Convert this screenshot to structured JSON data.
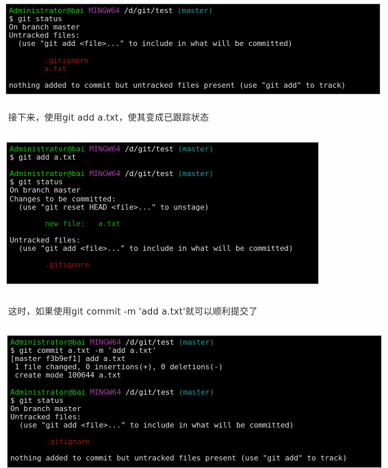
{
  "page": {
    "background": "#fefefe",
    "terminal_background": "#000000",
    "colors": {
      "user": "#19c419",
      "host": "#a43fa4",
      "path": "#e6e6e6",
      "branch": "#2a9d9d",
      "plain": "#dcdcdc",
      "untracked_red": "#a81414",
      "staged_green": "#19a819"
    }
  },
  "prompt": {
    "user": "Administrator@bai",
    "host": "MINGW64",
    "path": "/d/git/test",
    "branch": "(master)"
  },
  "terminal_1": {
    "name": "git-status-untracked-terminal",
    "lines": [
      {
        "type": "prompt"
      },
      {
        "type": "plain",
        "text": "$ git status"
      },
      {
        "type": "plain",
        "text": "On branch master"
      },
      {
        "type": "plain",
        "text": "Untracked files:"
      },
      {
        "type": "plain",
        "text": "  (use \"git add <file>...\" to include in what will be committed)"
      },
      {
        "type": "blank"
      },
      {
        "type": "red",
        "text": "        .gitignore"
      },
      {
        "type": "red",
        "text": "        a.txt"
      },
      {
        "type": "blank"
      },
      {
        "type": "plain",
        "text": "nothing added to commit but untracked files present (use \"git add\" to track)"
      }
    ]
  },
  "note_1": {
    "text": "接下来，使用git add a.txt，使其变成已跟踪状态"
  },
  "terminal_2": {
    "name": "git-add-terminal",
    "lines": [
      {
        "type": "prompt"
      },
      {
        "type": "plain",
        "text": "$ git add a.txt"
      },
      {
        "type": "blank"
      },
      {
        "type": "prompt"
      },
      {
        "type": "plain",
        "text": "$ git status"
      },
      {
        "type": "plain",
        "text": "On branch master"
      },
      {
        "type": "plain",
        "text": "Changes to be committed:"
      },
      {
        "type": "plain",
        "text": "  (use \"git reset HEAD <file>...\" to unstage)"
      },
      {
        "type": "blank"
      },
      {
        "type": "green",
        "text": "        new file:   a.txt"
      },
      {
        "type": "blank"
      },
      {
        "type": "plain",
        "text": "Untracked files:"
      },
      {
        "type": "plain",
        "text": "  (use \"git add <file>...\" to include in what will be committed)"
      },
      {
        "type": "blank"
      },
      {
        "type": "red",
        "text": "        .gitignore"
      },
      {
        "type": "blank"
      }
    ]
  },
  "note_2": {
    "text": "这时，如果使用git commit -m 'add a.txt'就可以顺利提交了"
  },
  "terminal_3": {
    "name": "git-commit-terminal",
    "lines": [
      {
        "type": "prompt"
      },
      {
        "type": "plain",
        "text": "$ git commit a.txt -m 'add a.txt'"
      },
      {
        "type": "plain",
        "text": "[master f3b9ef1] add a.txt"
      },
      {
        "type": "plain",
        "text": " 1 file changed, 0 insertions(+), 0 deletions(-)"
      },
      {
        "type": "plain",
        "text": " create mode 100644 a.txt"
      },
      {
        "type": "blank"
      },
      {
        "type": "prompt"
      },
      {
        "type": "plain",
        "text": "$ git status"
      },
      {
        "type": "plain",
        "text": "On branch master"
      },
      {
        "type": "plain",
        "text": "Untracked files:"
      },
      {
        "type": "plain",
        "text": "  (use \"git add <file>...\" to include in what will be committed)"
      },
      {
        "type": "blank"
      },
      {
        "type": "red",
        "text": "        .gitignore"
      },
      {
        "type": "blank"
      },
      {
        "type": "plain",
        "text": "nothing added to commit but untracked files present (use \"git add\" to track)"
      }
    ]
  }
}
